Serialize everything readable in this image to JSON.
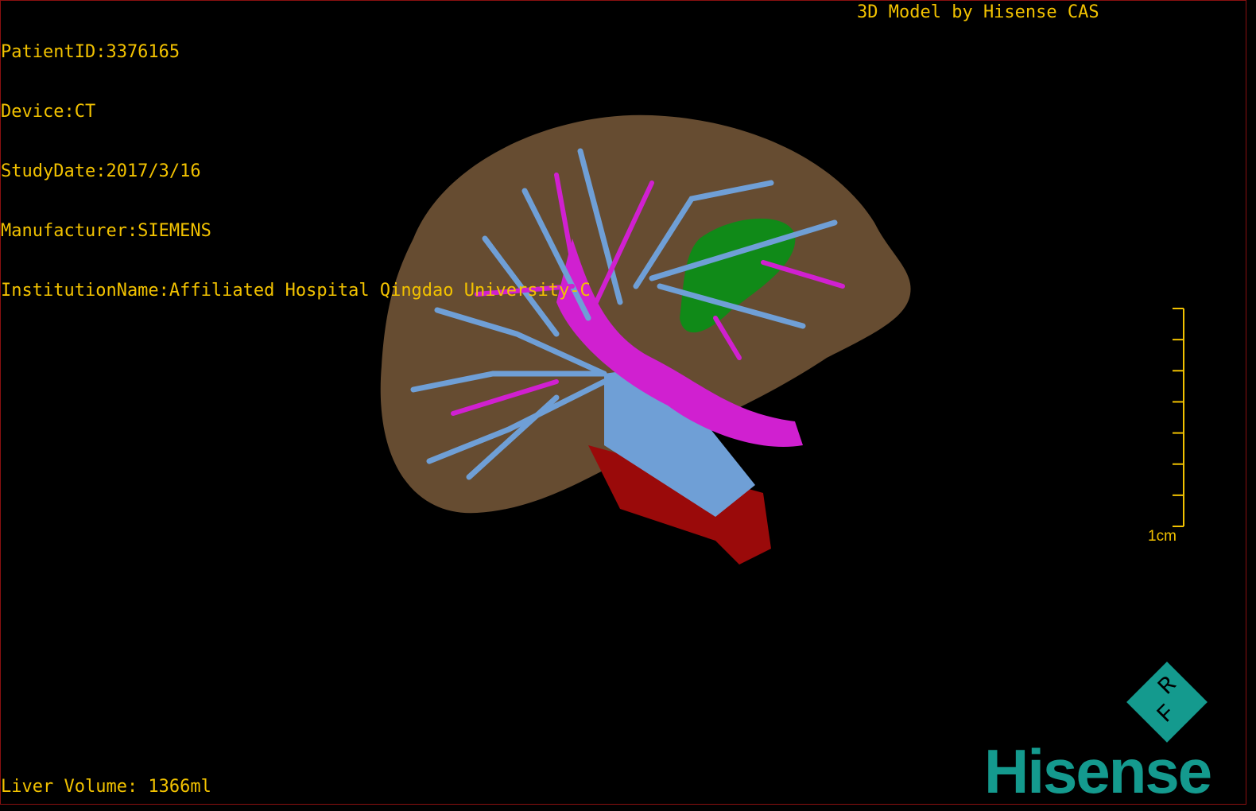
{
  "header": {
    "patient_id": "PatientID:3376165",
    "device": "Device:CT",
    "study_date": "StudyDate:2017/3/16",
    "manufacturer": "Manufacturer:SIEMENS",
    "institution": "InstitutionName:Affiliated Hospital Qingdao University-C",
    "brand_caption": "3D Model by Hisense CAS"
  },
  "footer": {
    "liver_volume": "Liver Volume: 1366ml"
  },
  "scale_bar": {
    "label": "1cm",
    "ticks": 8
  },
  "logo": {
    "name": "Hisense",
    "badge": "RF"
  },
  "colors": {
    "text": "#f2c200",
    "liver": "#6b5034",
    "hepatic_vein": "#6f9fd6",
    "portal_vein": "#d020d0",
    "gallbladder": "#108a18",
    "artery": "#a00a0a",
    "brand": "#149a8e"
  }
}
